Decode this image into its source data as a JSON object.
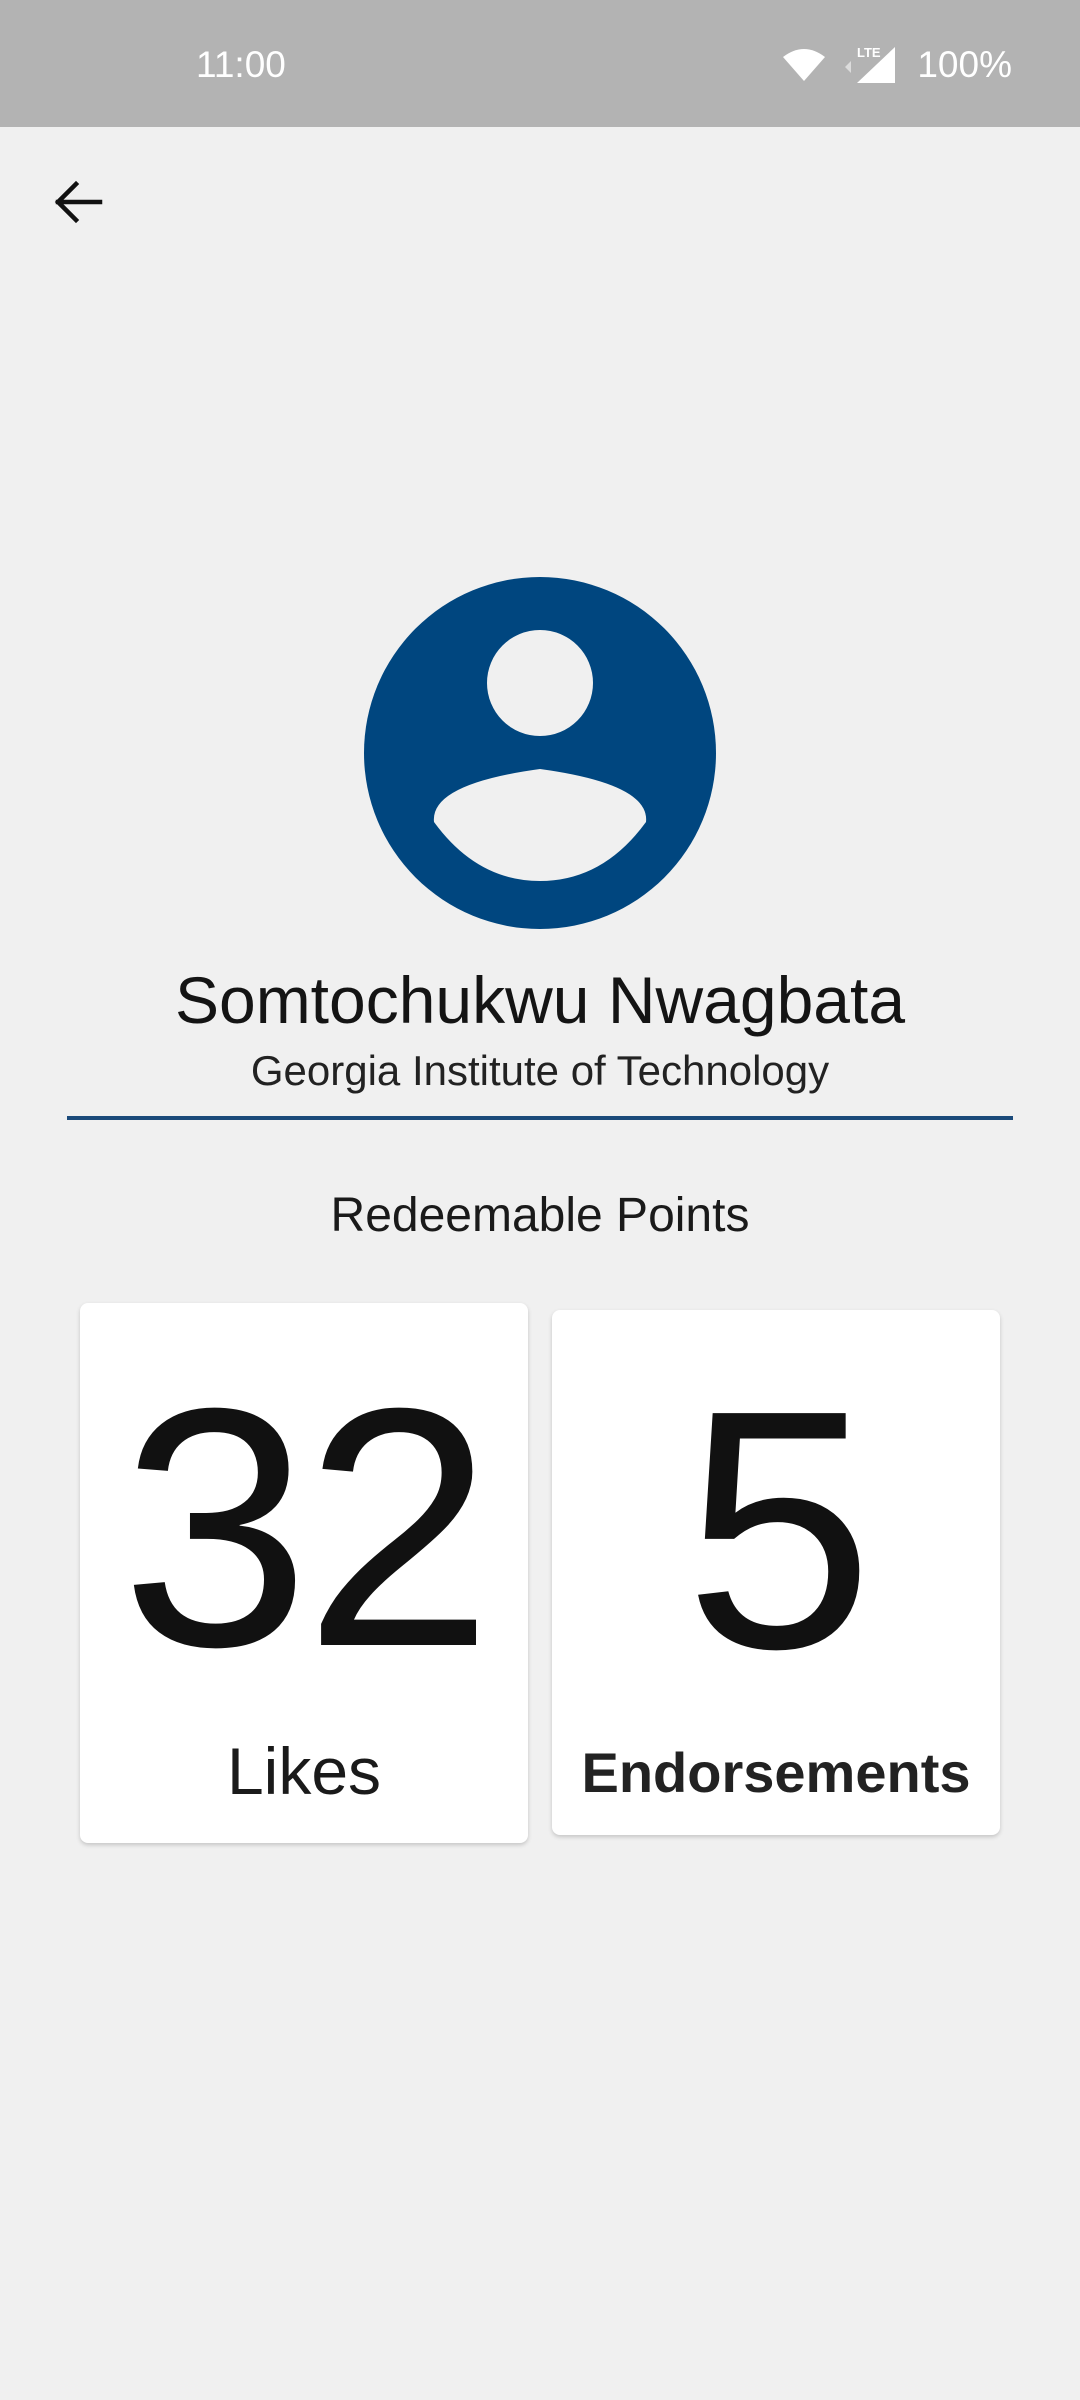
{
  "status_bar": {
    "time": "11:00",
    "network": "LTE",
    "battery": "100%",
    "icons": [
      "wifi-icon",
      "signal-icon"
    ]
  },
  "nav": {
    "back_icon": "arrow-left-icon"
  },
  "profile": {
    "avatar_icon": "account-circle-icon",
    "avatar_color": "#00467f",
    "name": "Somtochukwu Nwagbata",
    "school": "Georgia Institute of Technology"
  },
  "points": {
    "title": "Redeemable Points",
    "cards": [
      {
        "value": "32",
        "label": "Likes"
      },
      {
        "value": "5",
        "label": "Endorsements"
      }
    ]
  },
  "colors": {
    "background": "#f0f0f0",
    "status_bar": "#b3b3b3",
    "accent": "#1b4a7a"
  }
}
